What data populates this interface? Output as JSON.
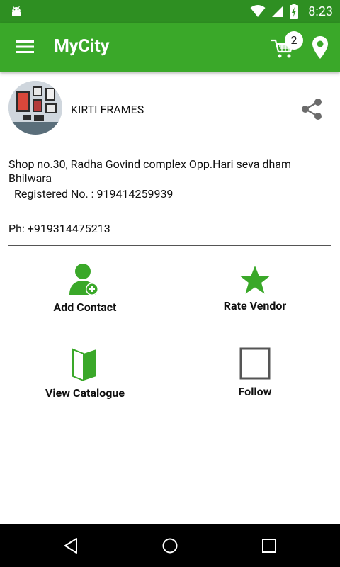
{
  "status_bar": {
    "time": "8:23"
  },
  "app_bar": {
    "title": "MyCity",
    "cart_count": "2"
  },
  "vendor": {
    "name": "KIRTI FRAMES",
    "address": "Shop no.30, Radha Govind complex Opp.Hari seva dham Bhilwara",
    "registered": "Registered No. : 919414259939",
    "phone": "Ph: +919314475213"
  },
  "actions": {
    "add_contact": "Add Contact",
    "rate_vendor": "Rate Vendor",
    "view_catalogue": "View Catalogue",
    "follow": "Follow"
  },
  "colors": {
    "status_bar": "#2e8f22",
    "app_bar": "#3aa829",
    "icon_green": "#3aa829"
  },
  "icons": {
    "android": "android-icon",
    "menu": "hamburger-icon",
    "cart": "cart-icon",
    "location": "location-pin-icon",
    "share": "share-icon",
    "add_contact": "add-person-icon",
    "rate": "star-icon",
    "catalogue": "book-icon",
    "follow": "checkbox-icon"
  }
}
